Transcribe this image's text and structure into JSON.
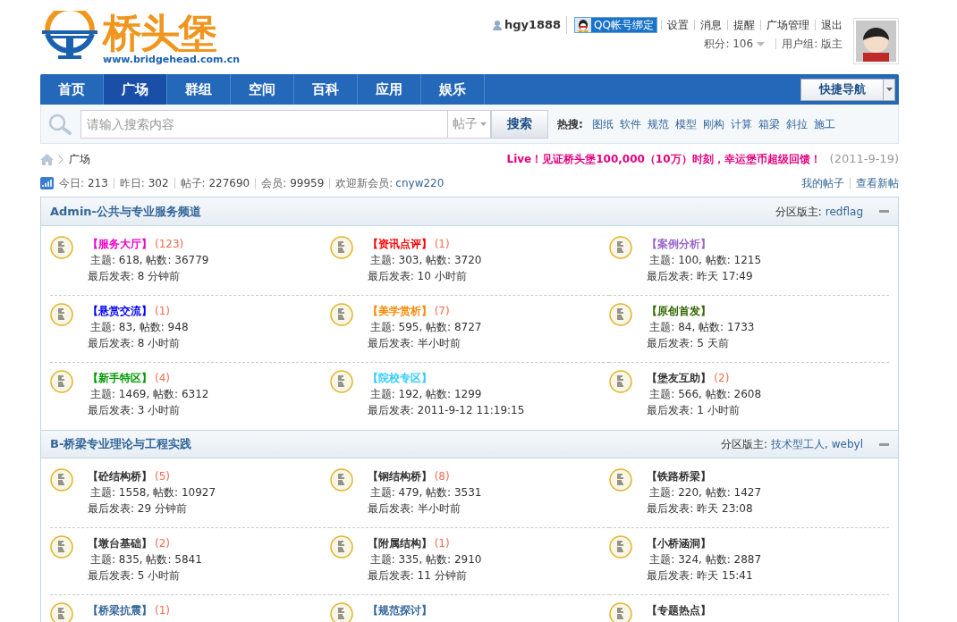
{
  "site": {
    "logo_text": "桥头堡",
    "logo_url": "www.bridgehead.com.cn"
  },
  "user": {
    "name": "hgy1888",
    "qq_button": "QQ帐号绑定",
    "links": [
      "设置",
      "消息",
      "提醒",
      "广场管理",
      "退出"
    ],
    "credits": "积分: 106",
    "group": "用户组: 版主"
  },
  "nav": {
    "items": [
      {
        "label": "首页",
        "selected": false
      },
      {
        "label": "广场",
        "selected": true
      },
      {
        "label": "群组",
        "selected": false
      },
      {
        "label": "空间",
        "selected": false
      },
      {
        "label": "百科",
        "selected": false
      },
      {
        "label": "应用",
        "selected": false
      },
      {
        "label": "娱乐",
        "selected": false
      }
    ],
    "quick_nav": "快捷导航"
  },
  "search": {
    "placeholder": "请输入搜索内容",
    "scope": "帖子",
    "button": "搜索",
    "hot_label": "热搜:",
    "hot": [
      "图纸",
      "软件",
      "规范",
      "模型",
      "刚构",
      "计算",
      "箱梁",
      "斜拉",
      "施工"
    ]
  },
  "breadcrumb": {
    "current": "广场"
  },
  "announcement": {
    "text": "Live！见证桥头堡100,000（10万）时刻，幸运堡币超级回馈！",
    "date": "(2011-9-19)"
  },
  "stats": [
    {
      "label": "今日:",
      "value": "213"
    },
    {
      "label": "昨日:",
      "value": "302"
    },
    {
      "label": "帖子:",
      "value": "227690"
    },
    {
      "label": "会员:",
      "value": "99959"
    }
  ],
  "welcome": {
    "label": "欢迎新会员:",
    "user": "cnyw220"
  },
  "my_links": [
    "我的帖子",
    "查看新帖"
  ],
  "sections": [
    {
      "title": "Admin-公共与专业服务频道",
      "moderator_label": "分区版主:",
      "moderators": "redflag",
      "forums": [
        {
          "name": "【服务大厅】",
          "color": "#ee00cc",
          "count": "(123)",
          "stats": "主题: 618, 帖数: 36779",
          "last_post": "最后发表: 8 分钟前"
        },
        {
          "name": "【资讯点评】",
          "color": "#ff0000",
          "count": "(1)",
          "stats": "主题: 303, 帖数: 3720",
          "last_post": "最后发表: 10 小时前"
        },
        {
          "name": "【案例分析】",
          "color": "#9966cc",
          "stats": "主题: 100, 帖数: 1215",
          "last_post": "最后发表: 昨天 17:49"
        },
        {
          "name": "【悬赏交流】",
          "color": "#0000ff",
          "count": "(1)",
          "stats": "主题: 83, 帖数: 948",
          "last_post": "最后发表: 8 小时前"
        },
        {
          "name": "【美学赏析】",
          "color": "#ff8800",
          "count": "(7)",
          "stats": "主题: 595, 帖数: 8727",
          "last_post": "最后发表: 半小时前"
        },
        {
          "name": "【原创首发】",
          "color": "#336600",
          "stats": "主题: 84, 帖数: 1733",
          "last_post": "最后发表: 5 天前"
        },
        {
          "name": "【新手特区】",
          "color": "#009900",
          "count": "(4)",
          "stats": "主题: 1469, 帖数: 6312",
          "last_post": "最后发表: 3 小时前"
        },
        {
          "name": "【院校专区】",
          "color": "#33ccff",
          "stats": "主题: 192, 帖数: 1299",
          "last_post": "最后发表: 2011-9-12 11:19:15"
        },
        {
          "name": "【堡友互助】",
          "color": "#333333",
          "count": "(2)",
          "stats": "主题: 566, 帖数: 2608",
          "last_post": "最后发表: 1 小时前"
        }
      ]
    },
    {
      "title": "B-桥梁专业理论与工程实践",
      "moderator_label": "分区版主:",
      "moderators": "技术型工人, webyl",
      "forums": [
        {
          "name": "【砼结构桥】",
          "color": "#333333",
          "count": "(5)",
          "stats": "主题: 1558, 帖数: 10927",
          "last_post": "最后发表: 29 分钟前"
        },
        {
          "name": "【钢结构桥】",
          "color": "#333333",
          "count": "(8)",
          "stats": "主题: 479, 帖数: 3531",
          "last_post": "最后发表: 半小时前"
        },
        {
          "name": "【铁路桥梁】",
          "color": "#333333",
          "stats": "主题: 220, 帖数: 1427",
          "last_post": "最后发表: 昨天 23:08"
        },
        {
          "name": "【墩台基础】",
          "color": "#333333",
          "count": "(2)",
          "stats": "主题: 835, 帖数: 5841",
          "last_post": "最后发表: 5 小时前"
        },
        {
          "name": "【附属结构】",
          "color": "#333333",
          "count": "(1)",
          "stats": "主题: 335, 帖数: 2910",
          "last_post": "最后发表: 11 分钟前"
        },
        {
          "name": "【小桥涵洞】",
          "color": "#333333",
          "stats": "主题: 324, 帖数: 2887",
          "last_post": "最后发表: 昨天 15:41"
        },
        {
          "name": "【桥梁抗震】",
          "color": "#336699",
          "count": "(1)"
        },
        {
          "name": "【规范探讨】",
          "color": "#336699"
        },
        {
          "name": "【专题热点】",
          "color": "#333333"
        }
      ]
    }
  ]
}
